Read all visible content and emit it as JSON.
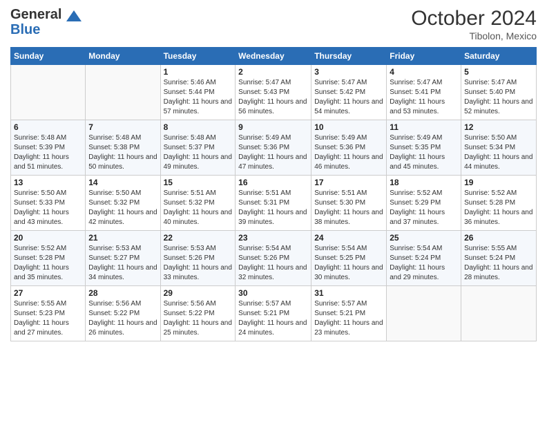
{
  "header": {
    "logo_line1": "General",
    "logo_line2": "Blue",
    "month": "October 2024",
    "location": "Tibolon, Mexico"
  },
  "columns": [
    "Sunday",
    "Monday",
    "Tuesday",
    "Wednesday",
    "Thursday",
    "Friday",
    "Saturday"
  ],
  "weeks": [
    [
      {
        "day": "",
        "info": ""
      },
      {
        "day": "",
        "info": ""
      },
      {
        "day": "1",
        "info": "Sunrise: 5:46 AM\nSunset: 5:44 PM\nDaylight: 11 hours and 57 minutes."
      },
      {
        "day": "2",
        "info": "Sunrise: 5:47 AM\nSunset: 5:43 PM\nDaylight: 11 hours and 56 minutes."
      },
      {
        "day": "3",
        "info": "Sunrise: 5:47 AM\nSunset: 5:42 PM\nDaylight: 11 hours and 54 minutes."
      },
      {
        "day": "4",
        "info": "Sunrise: 5:47 AM\nSunset: 5:41 PM\nDaylight: 11 hours and 53 minutes."
      },
      {
        "day": "5",
        "info": "Sunrise: 5:47 AM\nSunset: 5:40 PM\nDaylight: 11 hours and 52 minutes."
      }
    ],
    [
      {
        "day": "6",
        "info": "Sunrise: 5:48 AM\nSunset: 5:39 PM\nDaylight: 11 hours and 51 minutes."
      },
      {
        "day": "7",
        "info": "Sunrise: 5:48 AM\nSunset: 5:38 PM\nDaylight: 11 hours and 50 minutes."
      },
      {
        "day": "8",
        "info": "Sunrise: 5:48 AM\nSunset: 5:37 PM\nDaylight: 11 hours and 49 minutes."
      },
      {
        "day": "9",
        "info": "Sunrise: 5:49 AM\nSunset: 5:36 PM\nDaylight: 11 hours and 47 minutes."
      },
      {
        "day": "10",
        "info": "Sunrise: 5:49 AM\nSunset: 5:36 PM\nDaylight: 11 hours and 46 minutes."
      },
      {
        "day": "11",
        "info": "Sunrise: 5:49 AM\nSunset: 5:35 PM\nDaylight: 11 hours and 45 minutes."
      },
      {
        "day": "12",
        "info": "Sunrise: 5:50 AM\nSunset: 5:34 PM\nDaylight: 11 hours and 44 minutes."
      }
    ],
    [
      {
        "day": "13",
        "info": "Sunrise: 5:50 AM\nSunset: 5:33 PM\nDaylight: 11 hours and 43 minutes."
      },
      {
        "day": "14",
        "info": "Sunrise: 5:50 AM\nSunset: 5:32 PM\nDaylight: 11 hours and 42 minutes."
      },
      {
        "day": "15",
        "info": "Sunrise: 5:51 AM\nSunset: 5:32 PM\nDaylight: 11 hours and 40 minutes."
      },
      {
        "day": "16",
        "info": "Sunrise: 5:51 AM\nSunset: 5:31 PM\nDaylight: 11 hours and 39 minutes."
      },
      {
        "day": "17",
        "info": "Sunrise: 5:51 AM\nSunset: 5:30 PM\nDaylight: 11 hours and 38 minutes."
      },
      {
        "day": "18",
        "info": "Sunrise: 5:52 AM\nSunset: 5:29 PM\nDaylight: 11 hours and 37 minutes."
      },
      {
        "day": "19",
        "info": "Sunrise: 5:52 AM\nSunset: 5:28 PM\nDaylight: 11 hours and 36 minutes."
      }
    ],
    [
      {
        "day": "20",
        "info": "Sunrise: 5:52 AM\nSunset: 5:28 PM\nDaylight: 11 hours and 35 minutes."
      },
      {
        "day": "21",
        "info": "Sunrise: 5:53 AM\nSunset: 5:27 PM\nDaylight: 11 hours and 34 minutes."
      },
      {
        "day": "22",
        "info": "Sunrise: 5:53 AM\nSunset: 5:26 PM\nDaylight: 11 hours and 33 minutes."
      },
      {
        "day": "23",
        "info": "Sunrise: 5:54 AM\nSunset: 5:26 PM\nDaylight: 11 hours and 32 minutes."
      },
      {
        "day": "24",
        "info": "Sunrise: 5:54 AM\nSunset: 5:25 PM\nDaylight: 11 hours and 30 minutes."
      },
      {
        "day": "25",
        "info": "Sunrise: 5:54 AM\nSunset: 5:24 PM\nDaylight: 11 hours and 29 minutes."
      },
      {
        "day": "26",
        "info": "Sunrise: 5:55 AM\nSunset: 5:24 PM\nDaylight: 11 hours and 28 minutes."
      }
    ],
    [
      {
        "day": "27",
        "info": "Sunrise: 5:55 AM\nSunset: 5:23 PM\nDaylight: 11 hours and 27 minutes."
      },
      {
        "day": "28",
        "info": "Sunrise: 5:56 AM\nSunset: 5:22 PM\nDaylight: 11 hours and 26 minutes."
      },
      {
        "day": "29",
        "info": "Sunrise: 5:56 AM\nSunset: 5:22 PM\nDaylight: 11 hours and 25 minutes."
      },
      {
        "day": "30",
        "info": "Sunrise: 5:57 AM\nSunset: 5:21 PM\nDaylight: 11 hours and 24 minutes."
      },
      {
        "day": "31",
        "info": "Sunrise: 5:57 AM\nSunset: 5:21 PM\nDaylight: 11 hours and 23 minutes."
      },
      {
        "day": "",
        "info": ""
      },
      {
        "day": "",
        "info": ""
      }
    ]
  ]
}
